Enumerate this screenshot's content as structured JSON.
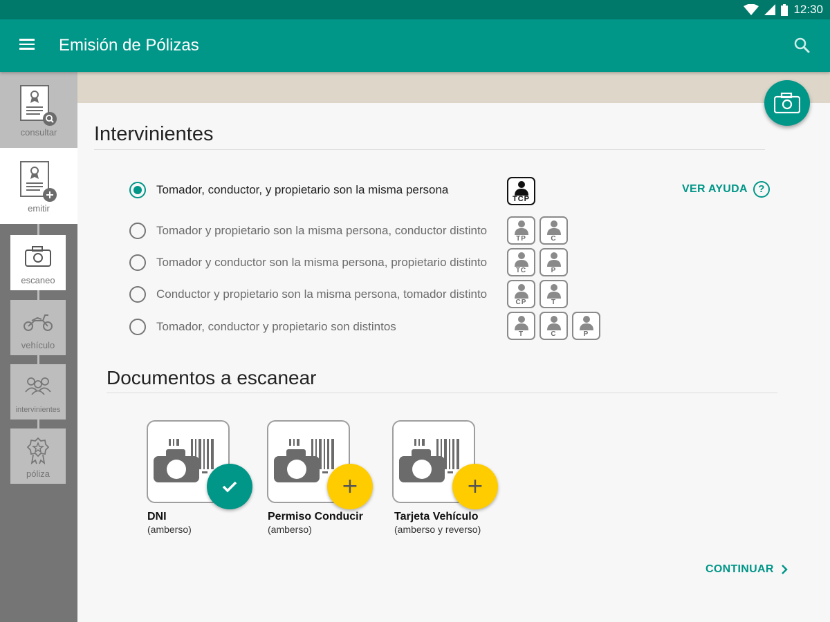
{
  "status": {
    "time": "12:30",
    "icons": [
      "wifi-icon",
      "signal-icon",
      "battery-icon"
    ]
  },
  "header": {
    "title": "Emisión de Pólizas",
    "menu_icon": "hamburger-icon",
    "search_icon": "search-icon"
  },
  "sidebar": {
    "items": [
      {
        "label": "consultar",
        "icon": "document-search-icon"
      },
      {
        "label": "emitir",
        "icon": "document-add-icon"
      },
      {
        "label": "escaneo",
        "icon": "camera-icon"
      },
      {
        "label": "vehículo",
        "icon": "motorcycle-icon"
      },
      {
        "label": "intervinientes",
        "icon": "people-icon"
      },
      {
        "label": "póliza",
        "icon": "rosette-icon"
      }
    ]
  },
  "fab": {
    "icon": "camera-icon"
  },
  "intervinientes": {
    "title": "Intervinientes",
    "help_label": "VER AYUDA",
    "help_icon": "?",
    "options": [
      {
        "label": "Tomador, conductor, y propietario son la misma persona",
        "selected": true,
        "tags": [
          "TCP"
        ]
      },
      {
        "label": "Tomador y propietario son la misma persona, conductor distinto",
        "selected": false,
        "tags": [
          "TP",
          "C"
        ]
      },
      {
        "label": "Tomador y conductor son la misma persona, propietario distinto",
        "selected": false,
        "tags": [
          "TC",
          "P"
        ]
      },
      {
        "label": "Conductor y propietario son la misma persona, tomador distinto",
        "selected": false,
        "tags": [
          "CP",
          "T"
        ]
      },
      {
        "label": "Tomador, conductor y propietario son distintos",
        "selected": false,
        "tags": [
          "T",
          "C",
          "P"
        ]
      }
    ]
  },
  "documentos": {
    "title": "Documentos a escanear",
    "items": [
      {
        "name": "DNI",
        "sub": "(amberso)",
        "status": "done",
        "badge_icon": "check-icon"
      },
      {
        "name": "Permiso Conducir",
        "sub": "(amberso)",
        "status": "add",
        "badge_text": "+"
      },
      {
        "name": "Tarjeta Vehículo",
        "sub": "(amberso y reverso)",
        "status": "add",
        "badge_text": "+"
      }
    ]
  },
  "footer": {
    "continue_label": "CONTINUAR"
  },
  "colors": {
    "primary": "#009688",
    "primary_dark": "#00796b",
    "accent": "#ffcc00",
    "sidebar": "#757575"
  }
}
